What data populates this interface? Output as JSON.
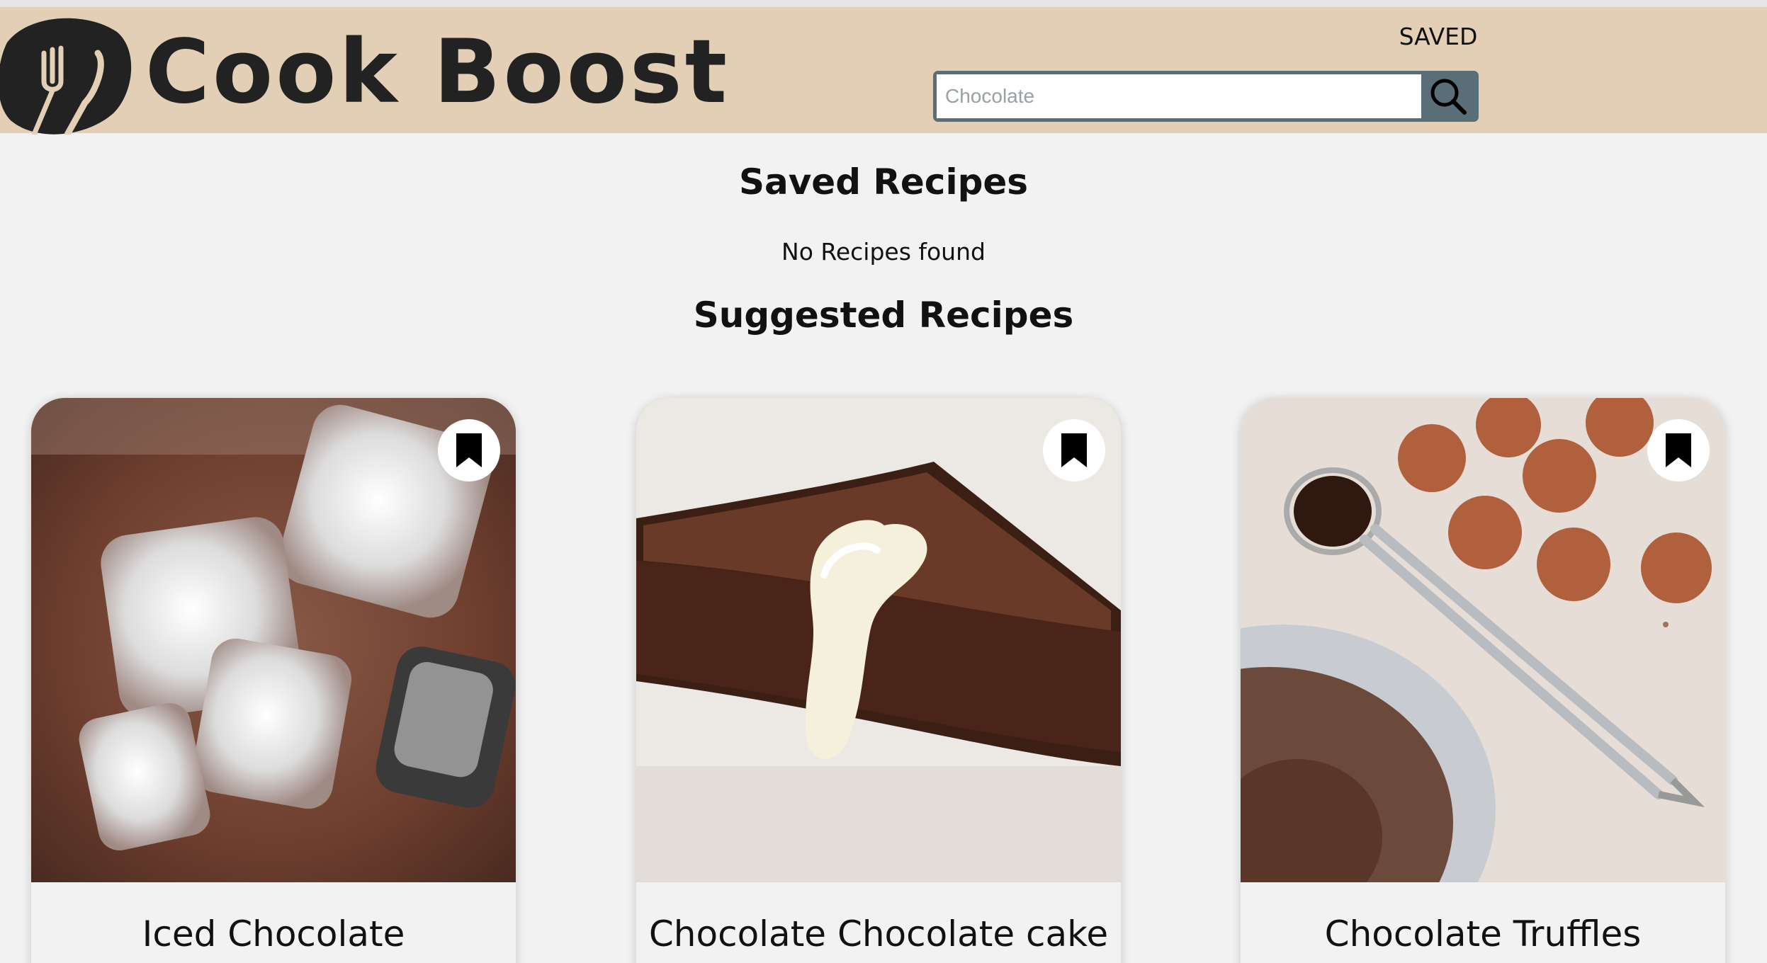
{
  "app": {
    "logo_text": "Cook Boost",
    "logo_icon": "utensils-icon"
  },
  "header": {
    "saved_label": "SAVED",
    "search": {
      "placeholder": "Chocolate",
      "value": "",
      "button_icon": "search-icon"
    },
    "colors": {
      "header_bg": "#e2cfb6",
      "search_accent": "#5a6e78"
    }
  },
  "saved_section": {
    "title": "Saved Recipes",
    "empty_message": "No Recipes found"
  },
  "suggested_section": {
    "title": "Suggested Recipes",
    "recipes": [
      {
        "title": "Iced Chocolate",
        "image": "iced-chocolate-photo",
        "bookmark_icon": "bookmark-icon"
      },
      {
        "title": "Chocolate Chocolate cake",
        "image": "chocolate-tart-photo",
        "bookmark_icon": "bookmark-icon"
      },
      {
        "title": "Chocolate Truffles",
        "image": "chocolate-truffles-photo",
        "bookmark_icon": "bookmark-icon"
      }
    ]
  }
}
